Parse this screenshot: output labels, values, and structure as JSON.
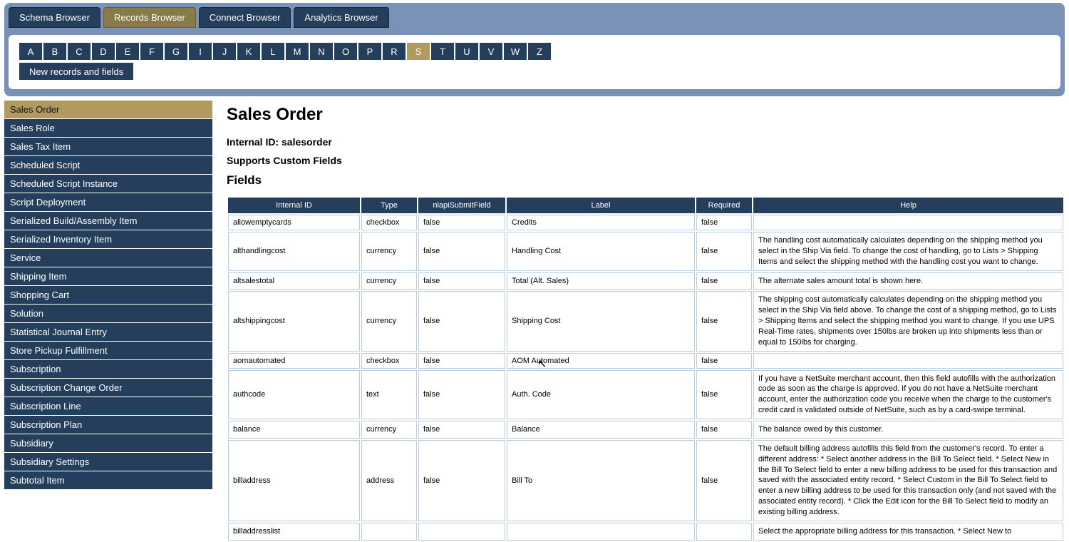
{
  "tabs": [
    {
      "label": "Schema Browser",
      "active": false
    },
    {
      "label": "Records Browser",
      "active": true
    },
    {
      "label": "Connect Browser",
      "active": false
    },
    {
      "label": "Analytics Browser",
      "active": false
    }
  ],
  "alpha": [
    "A",
    "B",
    "C",
    "D",
    "E",
    "F",
    "G",
    "I",
    "J",
    "K",
    "L",
    "M",
    "N",
    "O",
    "P",
    "R",
    "S",
    "T",
    "U",
    "V",
    "W",
    "Z"
  ],
  "alpha_active": "S",
  "alpha_extra": "New records and fields",
  "sidebar": [
    "Sales Order",
    "Sales Role",
    "Sales Tax Item",
    "Scheduled Script",
    "Scheduled Script Instance",
    "Script Deployment",
    "Serialized Build/Assembly Item",
    "Serialized Inventory Item",
    "Service",
    "Shipping Item",
    "Shopping Cart",
    "Solution",
    "Statistical Journal Entry",
    "Store Pickup Fulfillment",
    "Subscription",
    "Subscription Change Order",
    "Subscription Line",
    "Subscription Plan",
    "Subsidiary",
    "Subsidiary Settings",
    "Subtotal Item"
  ],
  "sidebar_active": 0,
  "page": {
    "title": "Sales Order",
    "internal_id_label": "Internal ID: salesorder",
    "supports": "Supports Custom Fields",
    "fields_heading": "Fields"
  },
  "columns": [
    "Internal ID",
    "Type",
    "nlapiSubmitField",
    "Label",
    "Required",
    "Help"
  ],
  "rows": [
    {
      "id": "allowemptycards",
      "type": "checkbox",
      "submit": "false",
      "label": "Credits",
      "req": "false",
      "help": ""
    },
    {
      "id": "althandlingcost",
      "type": "currency",
      "submit": "false",
      "label": "Handling Cost",
      "req": "false",
      "help": "The handling cost automatically calculates depending on the shipping method you select in the Ship Via field. To change the cost of handling, go to Lists > Shipping Items and select the shipping method with the handling cost you want to change."
    },
    {
      "id": "altsalestotal",
      "type": "currency",
      "submit": "false",
      "label": "Total (Alt. Sales)",
      "req": "false",
      "help": "The alternate sales amount total is shown here."
    },
    {
      "id": "altshippingcost",
      "type": "currency",
      "submit": "false",
      "label": "Shipping Cost",
      "req": "false",
      "help": "The shipping cost automatically calculates depending on the shipping method you select in the Ship Via field above. To change the cost of a shipping method, go to Lists > Shipping Items and select the shipping method you want to change. If you use UPS Real-Time rates, shipments over 150lbs are broken up into shipments less than or equal to 150lbs for charging."
    },
    {
      "id": "aomautomated",
      "type": "checkbox",
      "submit": "false",
      "label": "AOM Automated",
      "req": "false",
      "help": ""
    },
    {
      "id": "authcode",
      "type": "text",
      "submit": "false",
      "label": "Auth. Code",
      "req": "false",
      "help": "If you have a NetSuite merchant account, then this field autofills with the authorization code as soon as the charge is approved. If you do not have a NetSuite merchant account, enter the authorization code you receive when the charge to the customer's credit card is validated outside of NetSuite, such as by a card-swipe terminal."
    },
    {
      "id": "balance",
      "type": "currency",
      "submit": "false",
      "label": "Balance",
      "req": "false",
      "help": "The balance owed by this customer."
    },
    {
      "id": "billaddress",
      "type": "address",
      "submit": "false",
      "label": "Bill To",
      "req": "false",
      "help": "The default billing address autofills this field from the customer's record. To enter a different address: * Select another address in the Bill To Select field. * Select New in the Bill To Select field to enter a new billing address to be used for this transaction and saved with the associated entity record. * Select Custom in the Bill To Select field to enter a new billing address to be used for this transaction only (and not saved with the associated entity record). * Click the Edit icon for the Bill To Select field to modify an existing billing address."
    },
    {
      "id": "billaddresslist",
      "type": "",
      "submit": "",
      "label": "",
      "req": "",
      "help": "Select the appropriate billing address for this transaction. * Select New to"
    }
  ]
}
